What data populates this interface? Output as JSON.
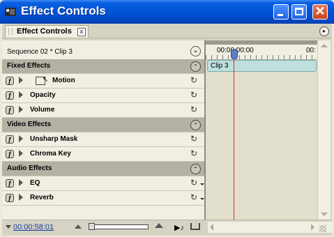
{
  "window": {
    "title": "Effect Controls"
  },
  "tab": {
    "label": "Effect Controls",
    "close": "x"
  },
  "sequence": {
    "label": "Sequence 02 * Clip 3"
  },
  "timeline": {
    "timecode_start": "00:00:00:00",
    "timecode_end": "00:",
    "clip_label": "Clip 3"
  },
  "sections": {
    "fixed": "Fixed Effects",
    "video": "Video Effects",
    "audio": "Audio Effects"
  },
  "effects": {
    "motion": "Motion",
    "opacity": "Opacity",
    "volume": "Volume",
    "unsharp": "Unsharp Mask",
    "chroma": "Chroma Key",
    "eq": "EQ",
    "reverb": "Reverb"
  },
  "bottom": {
    "current_timecode": "00:00:58:01"
  },
  "colors": {
    "title_blue": "#0052d6",
    "section_gray": "#b4b1a4",
    "clip_teal": "#bfdfdc",
    "playhead_red": "#d03030"
  }
}
